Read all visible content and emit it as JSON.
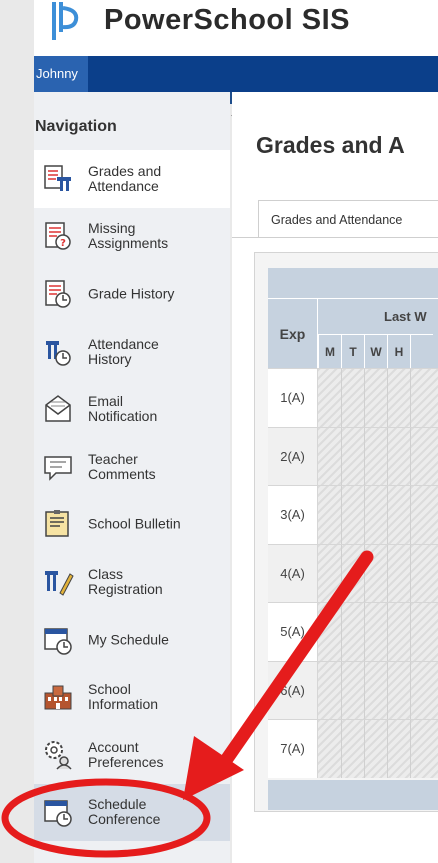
{
  "app": {
    "title": "PowerSchool SIS",
    "user": "Johnny"
  },
  "colors": {
    "brand": "#0b3f8a",
    "user_tab": "#2a63b0",
    "annotation": "#e51c1c"
  },
  "nav": {
    "heading": "Navigation",
    "items": [
      {
        "label": "Grades and\nAttendance",
        "icon": "grades-attendance-icon",
        "state": "active"
      },
      {
        "label": "Missing\nAssignments",
        "icon": "missing-assignments-icon"
      },
      {
        "label": "Grade History",
        "icon": "grade-history-icon"
      },
      {
        "label": "Attendance\nHistory",
        "icon": "attendance-history-icon"
      },
      {
        "label": "Email\nNotification",
        "icon": "email-icon"
      },
      {
        "label": "Teacher\nComments",
        "icon": "comment-icon"
      },
      {
        "label": "School Bulletin",
        "icon": "bulletin-icon"
      },
      {
        "label": "Class\nRegistration",
        "icon": "registration-icon"
      },
      {
        "label": "My Schedule",
        "icon": "schedule-icon"
      },
      {
        "label": "School\nInformation",
        "icon": "school-icon"
      },
      {
        "label": "Account\nPreferences",
        "icon": "preferences-icon"
      },
      {
        "label": "Schedule\nConference",
        "icon": "conference-icon",
        "state": "highlighted"
      }
    ]
  },
  "main": {
    "title": "Grades and A",
    "tab": "Grades and Attendance",
    "table": {
      "exp_header": "Exp",
      "week_header": "Last W",
      "days": [
        "M",
        "T",
        "W",
        "H",
        ""
      ],
      "rows": [
        "1(A)",
        "2(A)",
        "3(A)",
        "4(A)",
        "5(A)",
        "6(A)",
        "7(A)"
      ]
    }
  }
}
